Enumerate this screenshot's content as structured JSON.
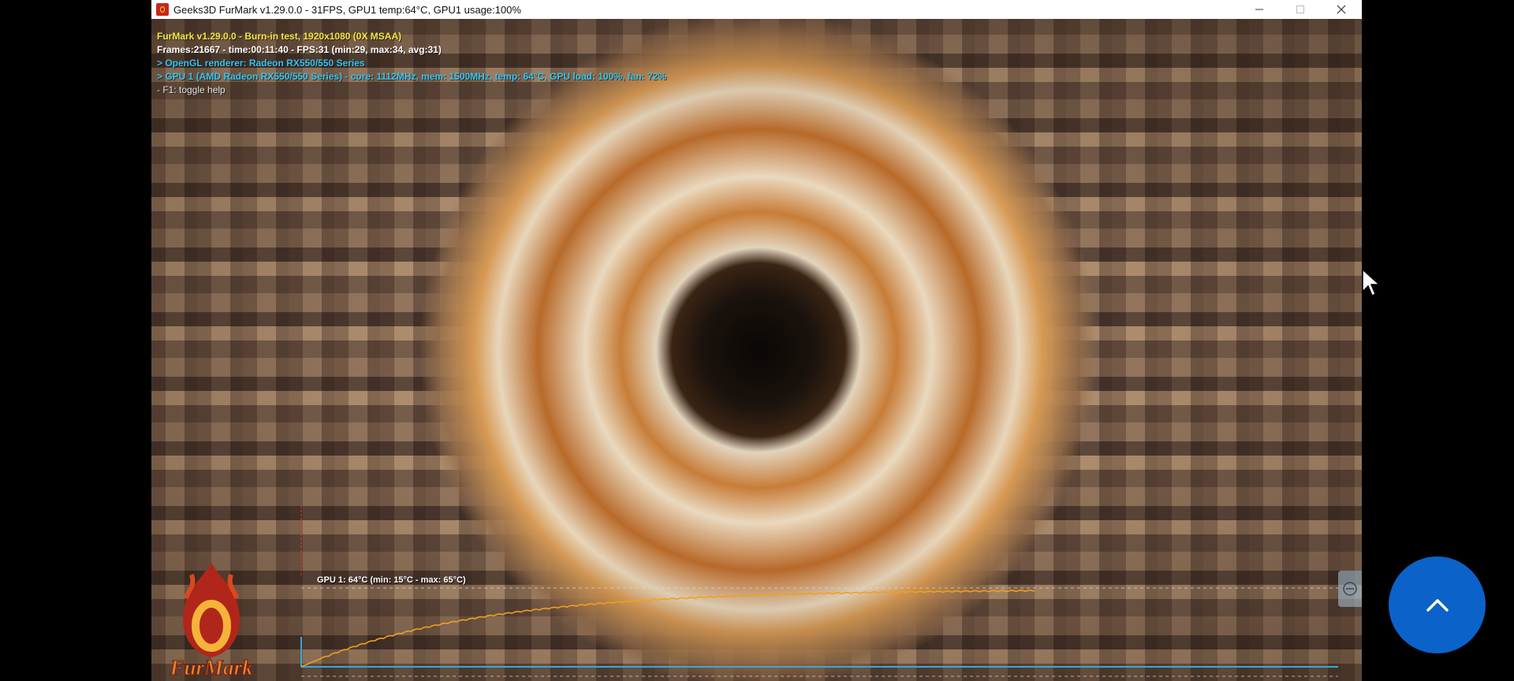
{
  "window": {
    "title": "Geeks3D FurMark v1.29.0.0 - 31FPS, GPU1 temp:64°C, GPU1 usage:100%",
    "controls": {
      "minimize": "—",
      "maximize": "☐",
      "close": "✕"
    }
  },
  "hud": {
    "line1": "FurMark v1.29.0.0 - Burn-in test, 1920x1080 (0X MSAA)",
    "line2": "Frames:21667 - time:00:11:40 - FPS:31 (min:29, max:34, avg:31)",
    "line3": "> OpenGL renderer: Radeon RX550/550 Series",
    "line4": "> GPU 1 (AMD Radeon RX550/550 Series) - core: 1112MHz, mem: 1500MHz, temp: 64°C, GPU load: 100%, fan: 72%",
    "line5": "- F1: toggle help"
  },
  "temp_graph": {
    "label": "GPU 1: 64°C (min: 15°C - max: 65°C)",
    "current_c": 64,
    "min_c": 15,
    "max_c": 65,
    "line_color": "#f0a020",
    "baseline_color": "#3aa7d8"
  },
  "logo": {
    "text": "FurMark"
  },
  "colors": {
    "hud_title": "#f2e640",
    "hud_info": "#35c4f2",
    "fab": "#0b62c9"
  },
  "icons": {
    "scroll_top": "chevron-up-icon",
    "side_tab": "monitor-icon"
  }
}
